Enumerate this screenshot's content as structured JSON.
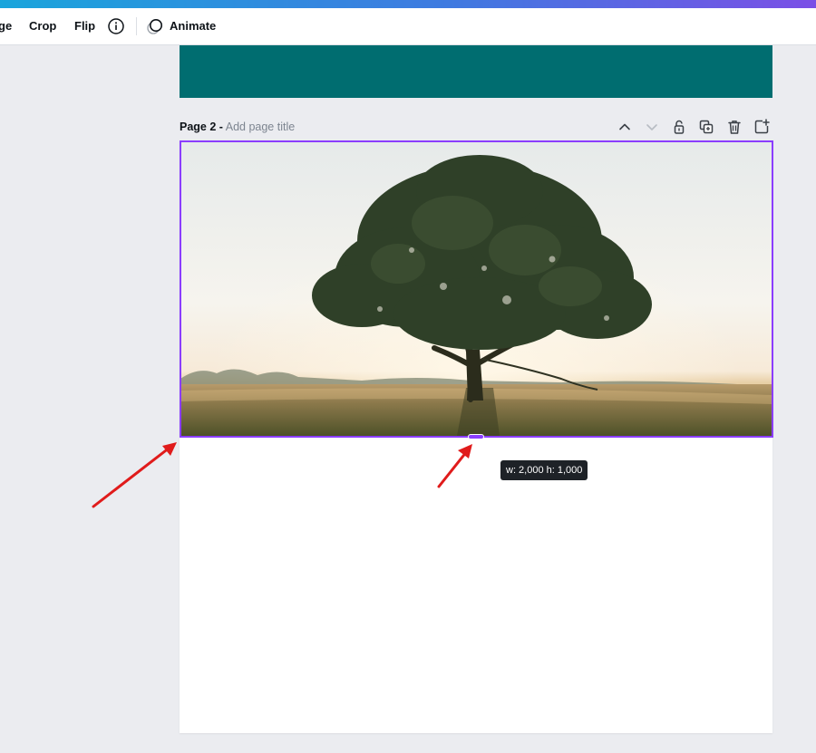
{
  "toolbar": {
    "partial_label": "ge",
    "crop_label": "Crop",
    "flip_label": "Flip",
    "animate_label": "Animate"
  },
  "page2": {
    "label": "Page 2 -",
    "title_placeholder": "Add page title"
  },
  "selection": {
    "size_tooltip": "w: 2,000 h: 1,000"
  },
  "colors": {
    "selection": "#8b3dff",
    "page1_fill": "#006d70",
    "annotation_arrow": "#e01b1b",
    "canvas_bg": "#ebecf0"
  },
  "icons": {
    "info": "info-icon",
    "animate": "animate-icon",
    "move_up": "chevron-up-icon",
    "move_down": "chevron-down-icon",
    "lock": "lock-icon",
    "duplicate": "duplicate-icon",
    "delete": "trash-icon",
    "add_page": "add-page-icon"
  }
}
